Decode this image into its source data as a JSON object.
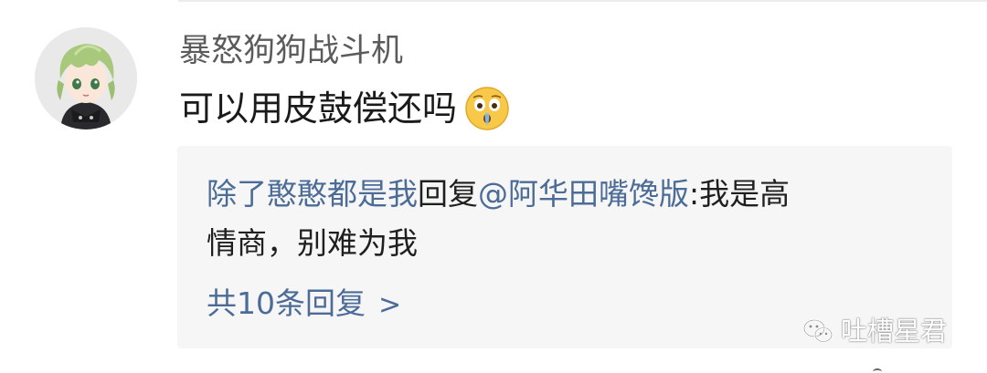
{
  "comment": {
    "username": "暴怒狗狗战斗机",
    "text": "可以用皮鼓偿还吗",
    "emoji": "crying-surprised-emoji"
  },
  "reply": {
    "author": "除了憨憨都是我",
    "reply_word": "回复",
    "mention": "@阿华田嘴馋版",
    "line1_text": ":我是高",
    "line2_text": "情商，别难为我",
    "count_label": "共10条回复",
    "chevron": ">"
  },
  "watermark": {
    "text": "吐槽星君",
    "icon": "wechat-icon"
  },
  "colors": {
    "link_blue": "#4c6c97",
    "reply_bg": "#f6f6f6",
    "username_gray": "#5b5b5b"
  }
}
